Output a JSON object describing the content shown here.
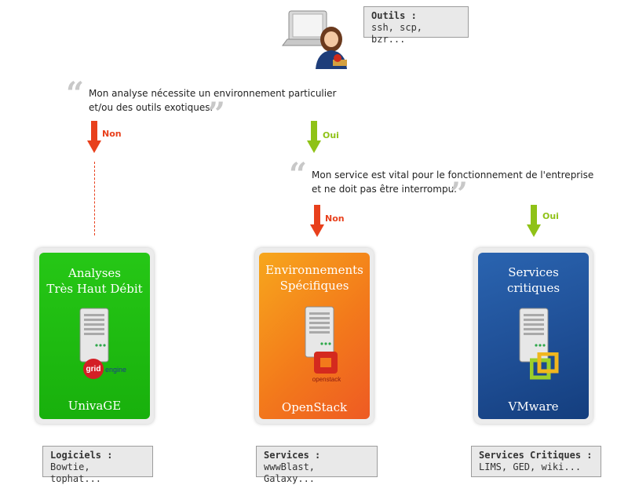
{
  "tools": {
    "title": "Outils :",
    "body": "ssh, scp, bzr..."
  },
  "quote1": {
    "line1": "Mon analyse nécessite un environnement particulier",
    "line2": "et/ou des outils exotiques."
  },
  "quote2": {
    "line1": "Mon service est vital pour le fonctionnement de l'entreprise",
    "line2": "et ne doit pas être interrompu."
  },
  "arrows": {
    "non1": "Non",
    "oui1": "Oui",
    "non2": "Non",
    "oui2": "Oui"
  },
  "colors": {
    "red": "#e8401c",
    "green": "#8fc217",
    "card_green": "#1fbd10",
    "card_orange": "#f37a1b",
    "card_blue": "#1f4f96"
  },
  "cards": [
    {
      "title_line1": "Analyses",
      "title_line2": "Très Haut Débit",
      "footer": "UnivaGE",
      "logo_word1": "grid",
      "logo_word2": "engine",
      "icon": "server-icon"
    },
    {
      "title_line1": "Environnements",
      "title_line2": "Spécifiques",
      "footer": "OpenStack",
      "logo_word1": "openstack",
      "icon": "server-icon"
    },
    {
      "title_line1": "Services",
      "title_line2": "critiques",
      "footer": "VMware",
      "icon": "server-icon"
    }
  ],
  "bottom_notes": [
    {
      "title": "Logiciels :",
      "body": "Bowtie, tophat..."
    },
    {
      "title": "Services :",
      "body": "wwwBlast, Galaxy..."
    },
    {
      "title": "Services Critiques :",
      "body": "LIMS, GED, wiki..."
    }
  ]
}
